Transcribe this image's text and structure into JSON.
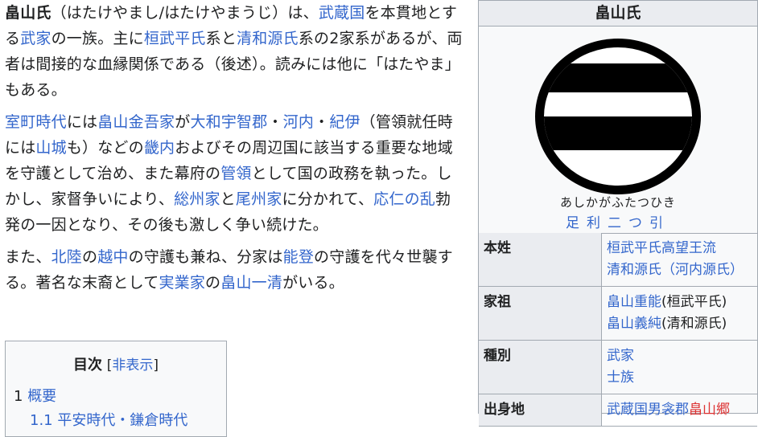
{
  "article": {
    "p1": {
      "t1": "畠山氏",
      "t2": "（はたけやまし/はたけやまうじ）は、",
      "l1": "武蔵国",
      "t3": "を本貫地とする",
      "l2": "武家",
      "t4": "の一族。主に",
      "l3": "桓武平氏",
      "t5": "系と",
      "l4": "清和源氏",
      "t6": "系の2家系があるが、両者は間接的な血縁関係である（後述）。読みには他に「はたやま」もある。"
    },
    "p2": {
      "l1": "室町時代",
      "t1": "には",
      "l2": "畠山金吾家",
      "t2": "が",
      "l3": "大和",
      "l4": "宇智郡",
      "t3": "・",
      "l5": "河内",
      "t4": "・",
      "l6": "紀伊",
      "t5": "（管領就任時には",
      "l7": "山城",
      "t6": "も）などの",
      "l8": "畿内",
      "t7": "およびその周辺国に該当する重要な地域を守護として治め、また幕府の",
      "l9": "管領",
      "t8": "として国の政務を執った。しかし、家督争いにより、",
      "l10": "総州家",
      "t9": "と",
      "l11": "尾州家",
      "t10": "に分かれて、",
      "l12": "応仁の乱",
      "t11": "勃発の一因となり、その後も激しく争い続けた。"
    },
    "p3": {
      "t1": "また、",
      "l1": "北陸",
      "t2": "の",
      "l2": "越中",
      "t3": "の守護も兼ね、分家は",
      "l3": "能登",
      "t4": "の守護を代々世襲する。著名な末裔として",
      "l4": "実業家",
      "t5": "の",
      "l5": "畠山一清",
      "t6": "がいる。"
    }
  },
  "toc": {
    "title": "目次",
    "toggle_open": "[",
    "toggle_label": "非表示",
    "toggle_close": "]",
    "item1_num": "1",
    "item1_label": "概要",
    "item2_label": "1.1 平安時代・鎌倉時代"
  },
  "infobox": {
    "title": "畠山氏",
    "emblem_ruby": "あしかがふたつひき",
    "emblem_caption": "足利二つ引",
    "rows": {
      "r1_label": "本姓",
      "r1_v1": "桓武平氏高望王流",
      "r1_v2": "清和源氏（河内源氏）",
      "r2_label": "家祖",
      "r2_v1a": "畠山重能",
      "r2_v1b": "(桓武平氏)",
      "r2_v2a": "畠山義純",
      "r2_v2b": "(清和源氏)",
      "r3_label": "種別",
      "r3_v1": "武家",
      "r3_v2": "士族",
      "r4_label": "出身地",
      "r4_v1": "武蔵国男衾郡",
      "r4_v2": "畠山郷"
    }
  }
}
